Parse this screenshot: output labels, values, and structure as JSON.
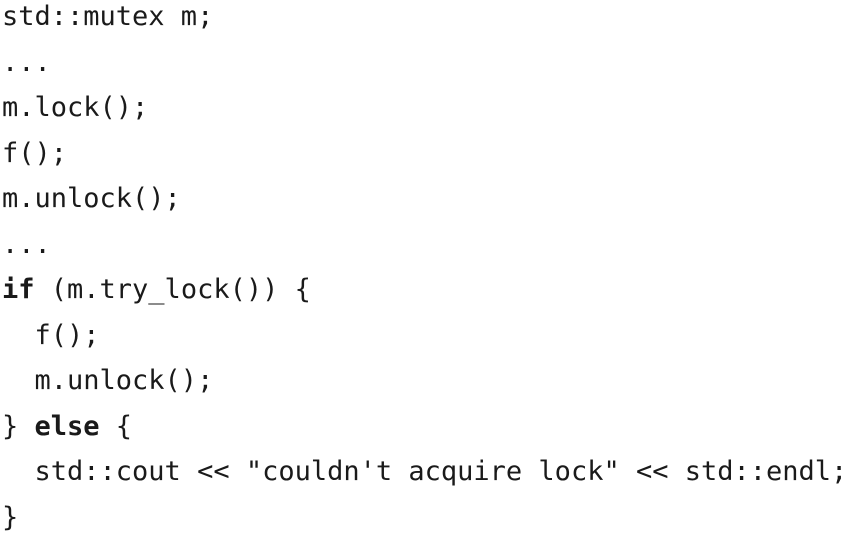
{
  "code": {
    "lines": [
      {
        "segments": [
          {
            "text": "std::mutex m;",
            "kind": "plain"
          }
        ]
      },
      {
        "segments": [
          {
            "text": "...",
            "kind": "plain"
          }
        ]
      },
      {
        "segments": [
          {
            "text": "m.lock();",
            "kind": "plain"
          }
        ]
      },
      {
        "segments": [
          {
            "text": "f();",
            "kind": "plain"
          }
        ]
      },
      {
        "segments": [
          {
            "text": "m.unlock();",
            "kind": "plain"
          }
        ]
      },
      {
        "segments": [
          {
            "text": "...",
            "kind": "plain"
          }
        ]
      },
      {
        "segments": [
          {
            "text": "if",
            "kind": "keyword"
          },
          {
            "text": " (m.try_lock()) {",
            "kind": "plain"
          }
        ]
      },
      {
        "segments": [
          {
            "text": "  f();",
            "kind": "plain"
          }
        ]
      },
      {
        "segments": [
          {
            "text": "  m.unlock();",
            "kind": "plain"
          }
        ]
      },
      {
        "segments": [
          {
            "text": "} ",
            "kind": "plain"
          },
          {
            "text": "else",
            "kind": "keyword"
          },
          {
            "text": " {",
            "kind": "plain"
          }
        ]
      },
      {
        "segments": [
          {
            "text": "  std::cout << \"couldn't acquire lock\" << std::endl;",
            "kind": "plain"
          }
        ]
      },
      {
        "segments": [
          {
            "text": "}",
            "kind": "plain"
          }
        ]
      }
    ]
  }
}
